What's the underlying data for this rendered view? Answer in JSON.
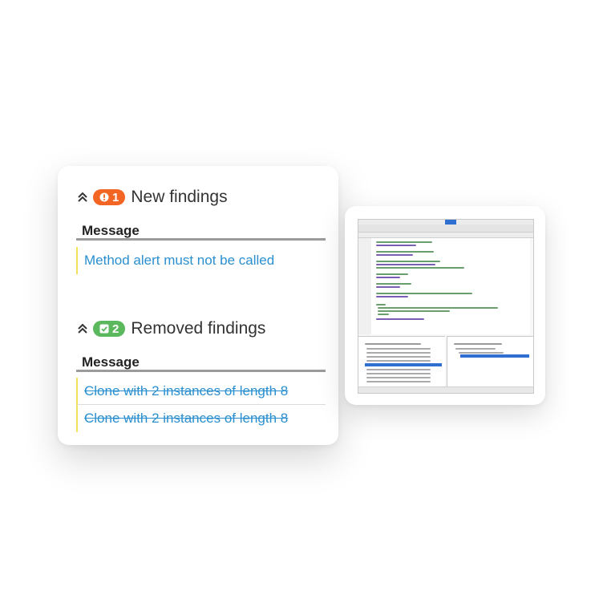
{
  "new_findings": {
    "count": "1",
    "title": "New findings",
    "column_header": "Message",
    "rows": [
      "Method alert must not be called"
    ]
  },
  "removed_findings": {
    "count": "2",
    "title": "Removed findings",
    "column_header": "Message",
    "rows": [
      "Clone with 2 instances of length 8",
      "Clone with 2 instances of length 8"
    ]
  },
  "colors": {
    "new_badge": "#f26522",
    "removed_badge": "#5cb85c",
    "link": "#2a8fd0",
    "row_marker": "#f5e25a"
  },
  "icons": {
    "collapse": "chevron-double-up-icon",
    "new_badge": "exclamation-circle-icon",
    "removed_badge": "check-square-icon"
  },
  "ide_thumbnail": {
    "description_icon": "ide-screenshot-thumbnail"
  }
}
